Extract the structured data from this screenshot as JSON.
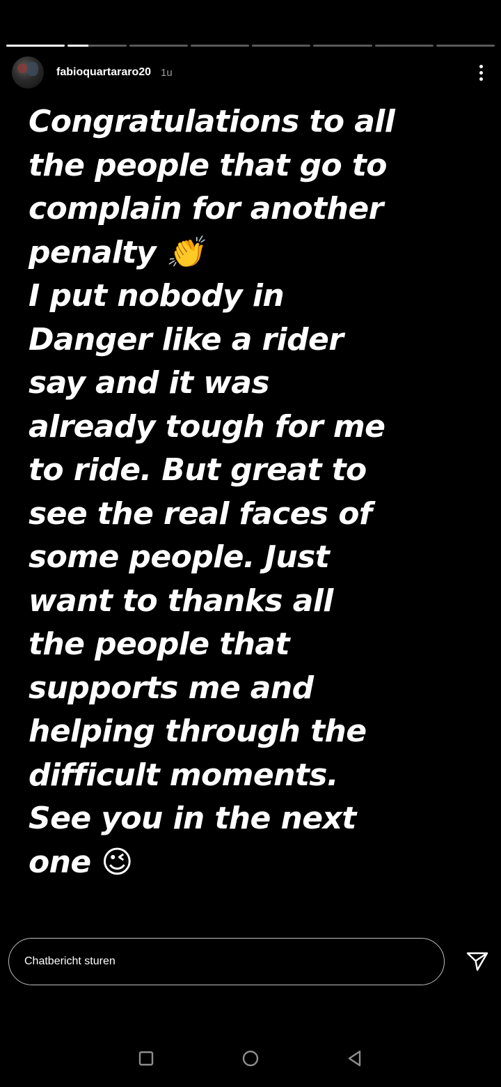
{
  "story": {
    "segments_total": 8,
    "current_segment": 2,
    "current_progress": 0.35,
    "username": "fabioquartararo20",
    "timestamp": "1u",
    "message": "Congratulations to all\nthe people that go to\ncomplain for another\npenalty 👏\nI put nobody in\nDanger like a rider\nsay and it was\nalready tough for me\nto ride. But great to\nsee the real faces of\nsome people. Just\nwant to thanks all\nthe people that\nsupports me and\nhelping through the\ndifficult moments.\nSee you in the next\none 😉"
  },
  "chat": {
    "placeholder": "Chatbericht sturen"
  },
  "nav": {
    "buttons": [
      "recents-button",
      "home-button",
      "back-button"
    ]
  },
  "colors": {
    "background": "#000000",
    "text": "#ffffff",
    "nav_icon": "#8e8e8e"
  }
}
